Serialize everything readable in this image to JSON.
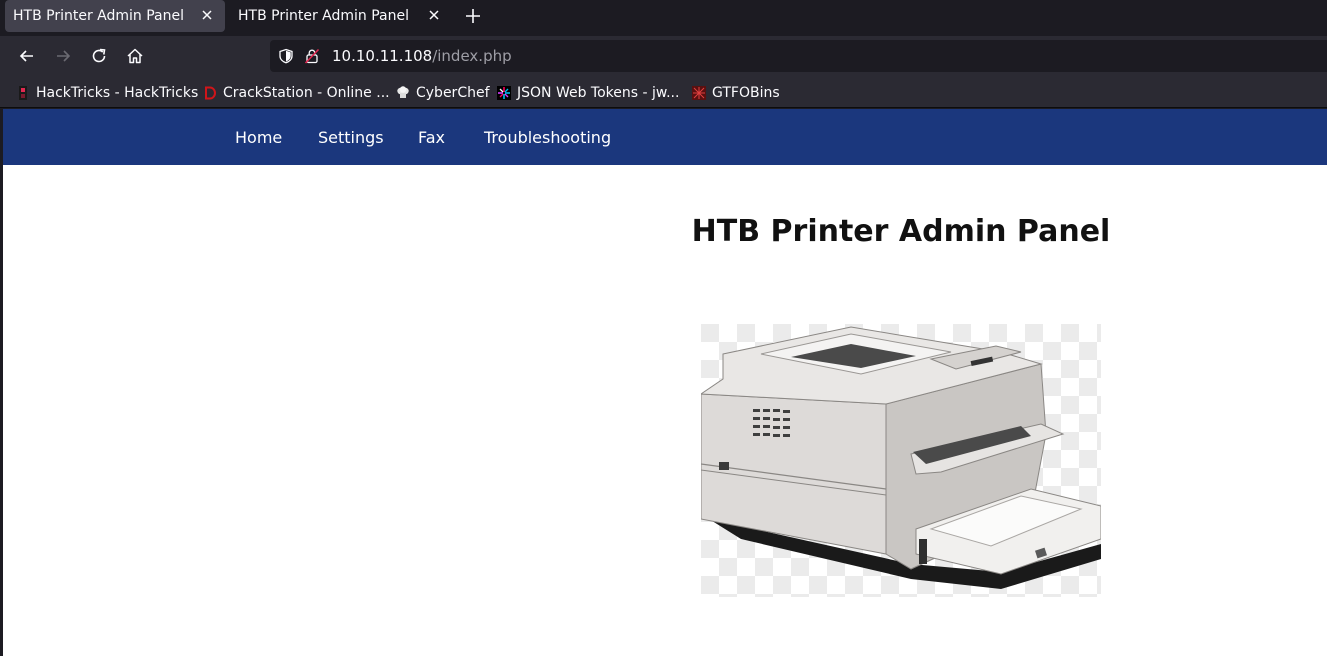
{
  "browser": {
    "tabs": [
      {
        "title": "HTB Printer Admin Panel",
        "active": true
      },
      {
        "title": "HTB Printer Admin Panel",
        "active": false
      }
    ],
    "url": {
      "host": "10.10.11.108",
      "path": "/index.php"
    },
    "bookmarks": [
      {
        "label": "HackTricks - HackTricks",
        "icon": "hacktricks-icon"
      },
      {
        "label": "CrackStation - Online ...",
        "icon": "crackstation-icon"
      },
      {
        "label": "CyberChef",
        "icon": "cyberchef-icon"
      },
      {
        "label": "JSON Web Tokens - jw...",
        "icon": "jwt-icon"
      },
      {
        "label": "GTFOBins",
        "icon": "gtfobins-icon"
      }
    ]
  },
  "site": {
    "nav": [
      "Home",
      "Settings",
      "Fax",
      "Troubleshooting"
    ],
    "nav_color": "#1b377d",
    "title": "HTB Printer Admin Panel",
    "image": "printer-image"
  }
}
